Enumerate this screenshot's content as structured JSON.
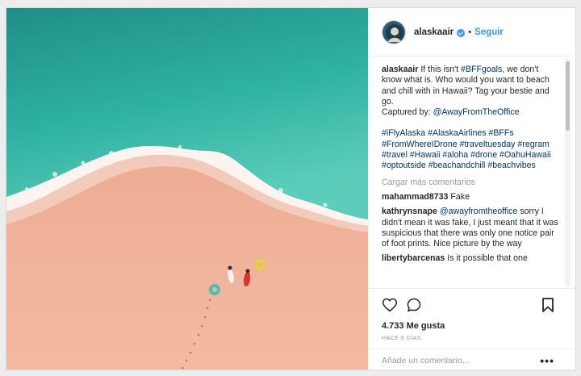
{
  "post": {
    "author": "alaskaair",
    "follow_label": "Seguir",
    "separator": "•",
    "caption": {
      "username": "alaskaair",
      "text": "If this isn't ",
      "hashtag_first": "#BFFgoals",
      "text_after": ", we don't know what is. Who would you want to beach and chill with in Hawaii? Tag your bestie and go.",
      "captured_by_label": "Captured by: ",
      "captured_by_link": "@AwayFromTheOffice",
      "hashtags": "#iFlyAlaska #AlaskaAirlines #BFFs #FromWhereIDrone #traveltuesday #regram #travel #Hawaii #aloha #drone #OahuHawaii #optoutside #beachandchill #beachvibes"
    },
    "load_more_label": "Cargar más comentarios",
    "comments": [
      {
        "username": "mahammad8733",
        "text": "Fake"
      },
      {
        "username": "kathrynsnape",
        "mention": "@awayfromtheoffice",
        "text": "sorry I didn't mean it was fake, I just meant that it was suspicious that there was only one notice pair of foot prints. Nice picture by the way"
      },
      {
        "username": "libertybarcenas",
        "text": "Is it possible that one"
      }
    ],
    "likes_label": "4.733 Me gusta",
    "time_label": "HACE 6 DÍAS",
    "add_comment_placeholder": "Añade un comentario...",
    "more_label": "•••"
  },
  "colors": {
    "link_blue": "#3897f0",
    "hashtag_blue": "#003569",
    "muted_gray": "#999999",
    "sea": "#2fa79a",
    "sand": "#f1b29a"
  },
  "icons": {
    "like": "heart-icon",
    "comment": "comment-icon",
    "save": "bookmark-icon",
    "verified": "verified-badge-icon"
  }
}
